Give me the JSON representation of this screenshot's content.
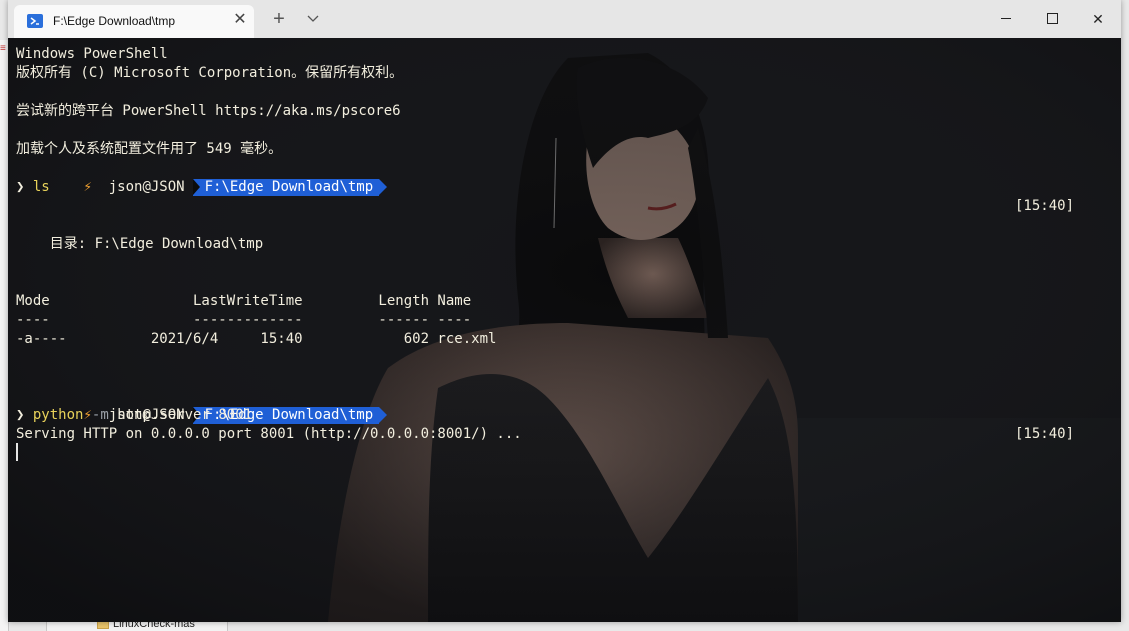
{
  "window": {
    "tab_title": "F:\\Edge Download\\tmp",
    "tab_icon": "powershell-icon",
    "close_glyph": "✕",
    "new_tab_glyph": "+",
    "minimize_glyph": "—",
    "close_window_glyph": "✕"
  },
  "terminal": {
    "banner_1": "Windows PowerShell",
    "banner_2": "版权所有 (C) Microsoft Corporation。保留所有权利。",
    "banner_3": "尝试新的跨平台 PowerShell https://aka.ms/pscore6",
    "banner_4": "加载个人及系统配置文件用了 549 毫秒。",
    "prompts": [
      {
        "bolt": "⚡",
        "user": "json@JSON",
        "path": "F:\\Edge Download\\tmp",
        "time": "[15:40]"
      },
      {
        "bolt": "⚡",
        "user": "json@JSON",
        "path": "F:\\Edge Download\\tmp",
        "time": "[15:40]"
      }
    ],
    "cmd1": {
      "chevron": "❯",
      "text": "ls"
    },
    "dir_line": "    目录: F:\\Edge Download\\tmp",
    "table_header": "Mode                 LastWriteTime         Length Name",
    "table_rule": "----                 -------------         ------ ----",
    "table_row": "-a----          2021/6/4     15:40            602 rce.xml",
    "cmd2": {
      "chevron": "❯",
      "program": "python",
      "flag": "-m",
      "args": "http.server 8001"
    },
    "server_line": "Serving HTTP on 0.0.0.0 port 8001 (http://0.0.0.0:8001/) ..."
  },
  "behind": {
    "bottom_item": "LinuxCheck-mas"
  },
  "colors": {
    "accent": "#1f5fd6",
    "bolt": "#f0a030",
    "command": "#e8d25a",
    "flag": "#9aa0a8",
    "text": "#f2eede"
  }
}
